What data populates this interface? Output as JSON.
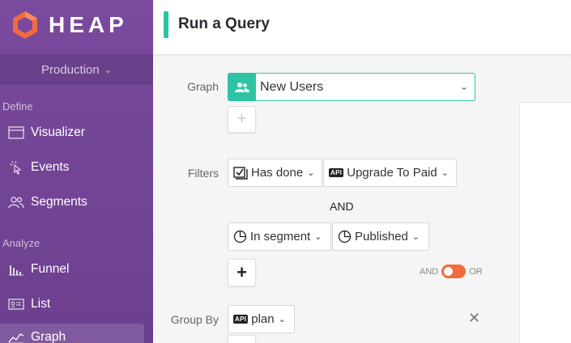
{
  "brand": {
    "name": "HEAP",
    "logo_color": "#f26b3a"
  },
  "sidebar": {
    "environment": "Production",
    "sections": [
      {
        "label": "Define"
      },
      {
        "label": "Analyze"
      }
    ],
    "items": [
      {
        "label": "Visualizer",
        "icon": "window-icon"
      },
      {
        "label": "Events",
        "icon": "cursor-click-icon"
      },
      {
        "label": "Segments",
        "icon": "users-icon"
      },
      {
        "label": "Funnel",
        "icon": "funnel-bars-icon"
      },
      {
        "label": "List",
        "icon": "list-card-icon"
      },
      {
        "label": "Graph",
        "icon": "line-graph-icon",
        "active": true
      }
    ]
  },
  "header": {
    "title": "Run a Query",
    "accent_color": "#2ec4a3"
  },
  "query": {
    "graph_label": "Graph",
    "graph_value": "New Users",
    "filters_label": "Filters",
    "filter1": {
      "condition": "Has done",
      "event": "Upgrade To Paid",
      "event_badge": "API"
    },
    "and_joiner": "AND",
    "filter2": {
      "condition": "In segment",
      "segment": "Published"
    },
    "toggle": {
      "left": "AND",
      "right": "OR",
      "color": "#f26b3a"
    },
    "group_by_label": "Group By",
    "group_by": {
      "value": "plan",
      "badge": "API"
    }
  }
}
